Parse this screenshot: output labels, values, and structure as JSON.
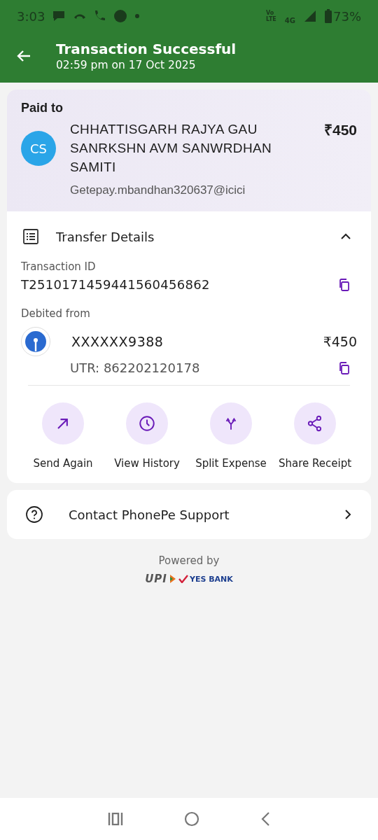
{
  "status_bar": {
    "time": "3:03",
    "network_top": "Vo",
    "network_bottom": "LTE",
    "network_type": "4G",
    "battery": "73%"
  },
  "header": {
    "title": "Transaction Successful",
    "subtitle": "02:59 pm on 17 Oct 2025"
  },
  "paid_to": {
    "label": "Paid to",
    "avatar": "CS",
    "name": "CHHATTISGARH RAJYA GAU SANRKSHN AVM SANWRDHAN SAMITI",
    "amount": "₹450",
    "upi_id": "Getepay.mbandhan320637@icici"
  },
  "transfer_details": {
    "title": "Transfer Details",
    "expanded": true,
    "transaction_id_label": "Transaction ID",
    "transaction_id": "T2510171459441560456862",
    "debited_from_label": "Debited from",
    "account": "XXXXXX9388",
    "amount": "₹450",
    "utr": "UTR: 862202120178"
  },
  "actions": [
    {
      "kind": "send",
      "label": "Send Again"
    },
    {
      "kind": "history",
      "label": "View History"
    },
    {
      "kind": "split",
      "label": "Split Expense"
    },
    {
      "kind": "share",
      "label": "Share Receipt"
    }
  ],
  "support": {
    "label": "Contact PhonePe Support"
  },
  "footer": {
    "powered_by": "Powered by",
    "upi": "UPI",
    "bank": "YES BANK"
  }
}
